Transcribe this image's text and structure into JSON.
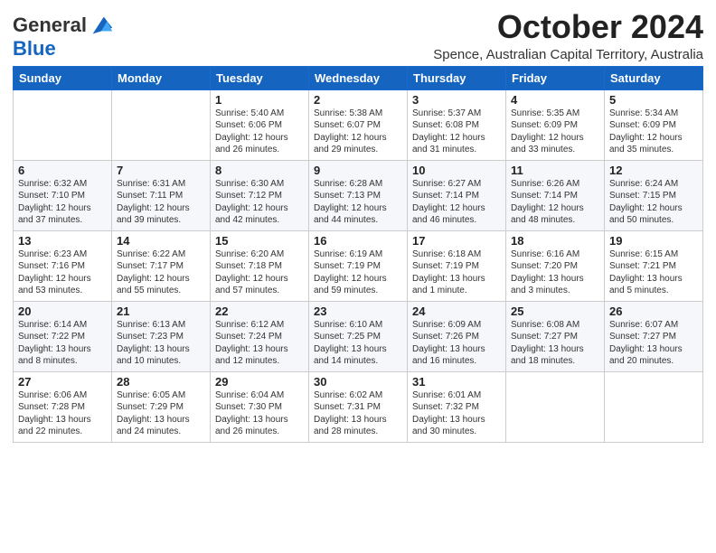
{
  "logo": {
    "line1": "General",
    "line2": "Blue"
  },
  "title": "October 2024",
  "subtitle": "Spence, Australian Capital Territory, Australia",
  "days_of_week": [
    "Sunday",
    "Monday",
    "Tuesday",
    "Wednesday",
    "Thursday",
    "Friday",
    "Saturday"
  ],
  "weeks": [
    [
      {
        "day": "",
        "info": ""
      },
      {
        "day": "",
        "info": ""
      },
      {
        "day": "1",
        "info": "Sunrise: 5:40 AM\nSunset: 6:06 PM\nDaylight: 12 hours\nand 26 minutes."
      },
      {
        "day": "2",
        "info": "Sunrise: 5:38 AM\nSunset: 6:07 PM\nDaylight: 12 hours\nand 29 minutes."
      },
      {
        "day": "3",
        "info": "Sunrise: 5:37 AM\nSunset: 6:08 PM\nDaylight: 12 hours\nand 31 minutes."
      },
      {
        "day": "4",
        "info": "Sunrise: 5:35 AM\nSunset: 6:09 PM\nDaylight: 12 hours\nand 33 minutes."
      },
      {
        "day": "5",
        "info": "Sunrise: 5:34 AM\nSunset: 6:09 PM\nDaylight: 12 hours\nand 35 minutes."
      }
    ],
    [
      {
        "day": "6",
        "info": "Sunrise: 6:32 AM\nSunset: 7:10 PM\nDaylight: 12 hours\nand 37 minutes."
      },
      {
        "day": "7",
        "info": "Sunrise: 6:31 AM\nSunset: 7:11 PM\nDaylight: 12 hours\nand 39 minutes."
      },
      {
        "day": "8",
        "info": "Sunrise: 6:30 AM\nSunset: 7:12 PM\nDaylight: 12 hours\nand 42 minutes."
      },
      {
        "day": "9",
        "info": "Sunrise: 6:28 AM\nSunset: 7:13 PM\nDaylight: 12 hours\nand 44 minutes."
      },
      {
        "day": "10",
        "info": "Sunrise: 6:27 AM\nSunset: 7:14 PM\nDaylight: 12 hours\nand 46 minutes."
      },
      {
        "day": "11",
        "info": "Sunrise: 6:26 AM\nSunset: 7:14 PM\nDaylight: 12 hours\nand 48 minutes."
      },
      {
        "day": "12",
        "info": "Sunrise: 6:24 AM\nSunset: 7:15 PM\nDaylight: 12 hours\nand 50 minutes."
      }
    ],
    [
      {
        "day": "13",
        "info": "Sunrise: 6:23 AM\nSunset: 7:16 PM\nDaylight: 12 hours\nand 53 minutes."
      },
      {
        "day": "14",
        "info": "Sunrise: 6:22 AM\nSunset: 7:17 PM\nDaylight: 12 hours\nand 55 minutes."
      },
      {
        "day": "15",
        "info": "Sunrise: 6:20 AM\nSunset: 7:18 PM\nDaylight: 12 hours\nand 57 minutes."
      },
      {
        "day": "16",
        "info": "Sunrise: 6:19 AM\nSunset: 7:19 PM\nDaylight: 12 hours\nand 59 minutes."
      },
      {
        "day": "17",
        "info": "Sunrise: 6:18 AM\nSunset: 7:19 PM\nDaylight: 13 hours\nand 1 minute."
      },
      {
        "day": "18",
        "info": "Sunrise: 6:16 AM\nSunset: 7:20 PM\nDaylight: 13 hours\nand 3 minutes."
      },
      {
        "day": "19",
        "info": "Sunrise: 6:15 AM\nSunset: 7:21 PM\nDaylight: 13 hours\nand 5 minutes."
      }
    ],
    [
      {
        "day": "20",
        "info": "Sunrise: 6:14 AM\nSunset: 7:22 PM\nDaylight: 13 hours\nand 8 minutes."
      },
      {
        "day": "21",
        "info": "Sunrise: 6:13 AM\nSunset: 7:23 PM\nDaylight: 13 hours\nand 10 minutes."
      },
      {
        "day": "22",
        "info": "Sunrise: 6:12 AM\nSunset: 7:24 PM\nDaylight: 13 hours\nand 12 minutes."
      },
      {
        "day": "23",
        "info": "Sunrise: 6:10 AM\nSunset: 7:25 PM\nDaylight: 13 hours\nand 14 minutes."
      },
      {
        "day": "24",
        "info": "Sunrise: 6:09 AM\nSunset: 7:26 PM\nDaylight: 13 hours\nand 16 minutes."
      },
      {
        "day": "25",
        "info": "Sunrise: 6:08 AM\nSunset: 7:27 PM\nDaylight: 13 hours\nand 18 minutes."
      },
      {
        "day": "26",
        "info": "Sunrise: 6:07 AM\nSunset: 7:27 PM\nDaylight: 13 hours\nand 20 minutes."
      }
    ],
    [
      {
        "day": "27",
        "info": "Sunrise: 6:06 AM\nSunset: 7:28 PM\nDaylight: 13 hours\nand 22 minutes."
      },
      {
        "day": "28",
        "info": "Sunrise: 6:05 AM\nSunset: 7:29 PM\nDaylight: 13 hours\nand 24 minutes."
      },
      {
        "day": "29",
        "info": "Sunrise: 6:04 AM\nSunset: 7:30 PM\nDaylight: 13 hours\nand 26 minutes."
      },
      {
        "day": "30",
        "info": "Sunrise: 6:02 AM\nSunset: 7:31 PM\nDaylight: 13 hours\nand 28 minutes."
      },
      {
        "day": "31",
        "info": "Sunrise: 6:01 AM\nSunset: 7:32 PM\nDaylight: 13 hours\nand 30 minutes."
      },
      {
        "day": "",
        "info": ""
      },
      {
        "day": "",
        "info": ""
      }
    ]
  ]
}
